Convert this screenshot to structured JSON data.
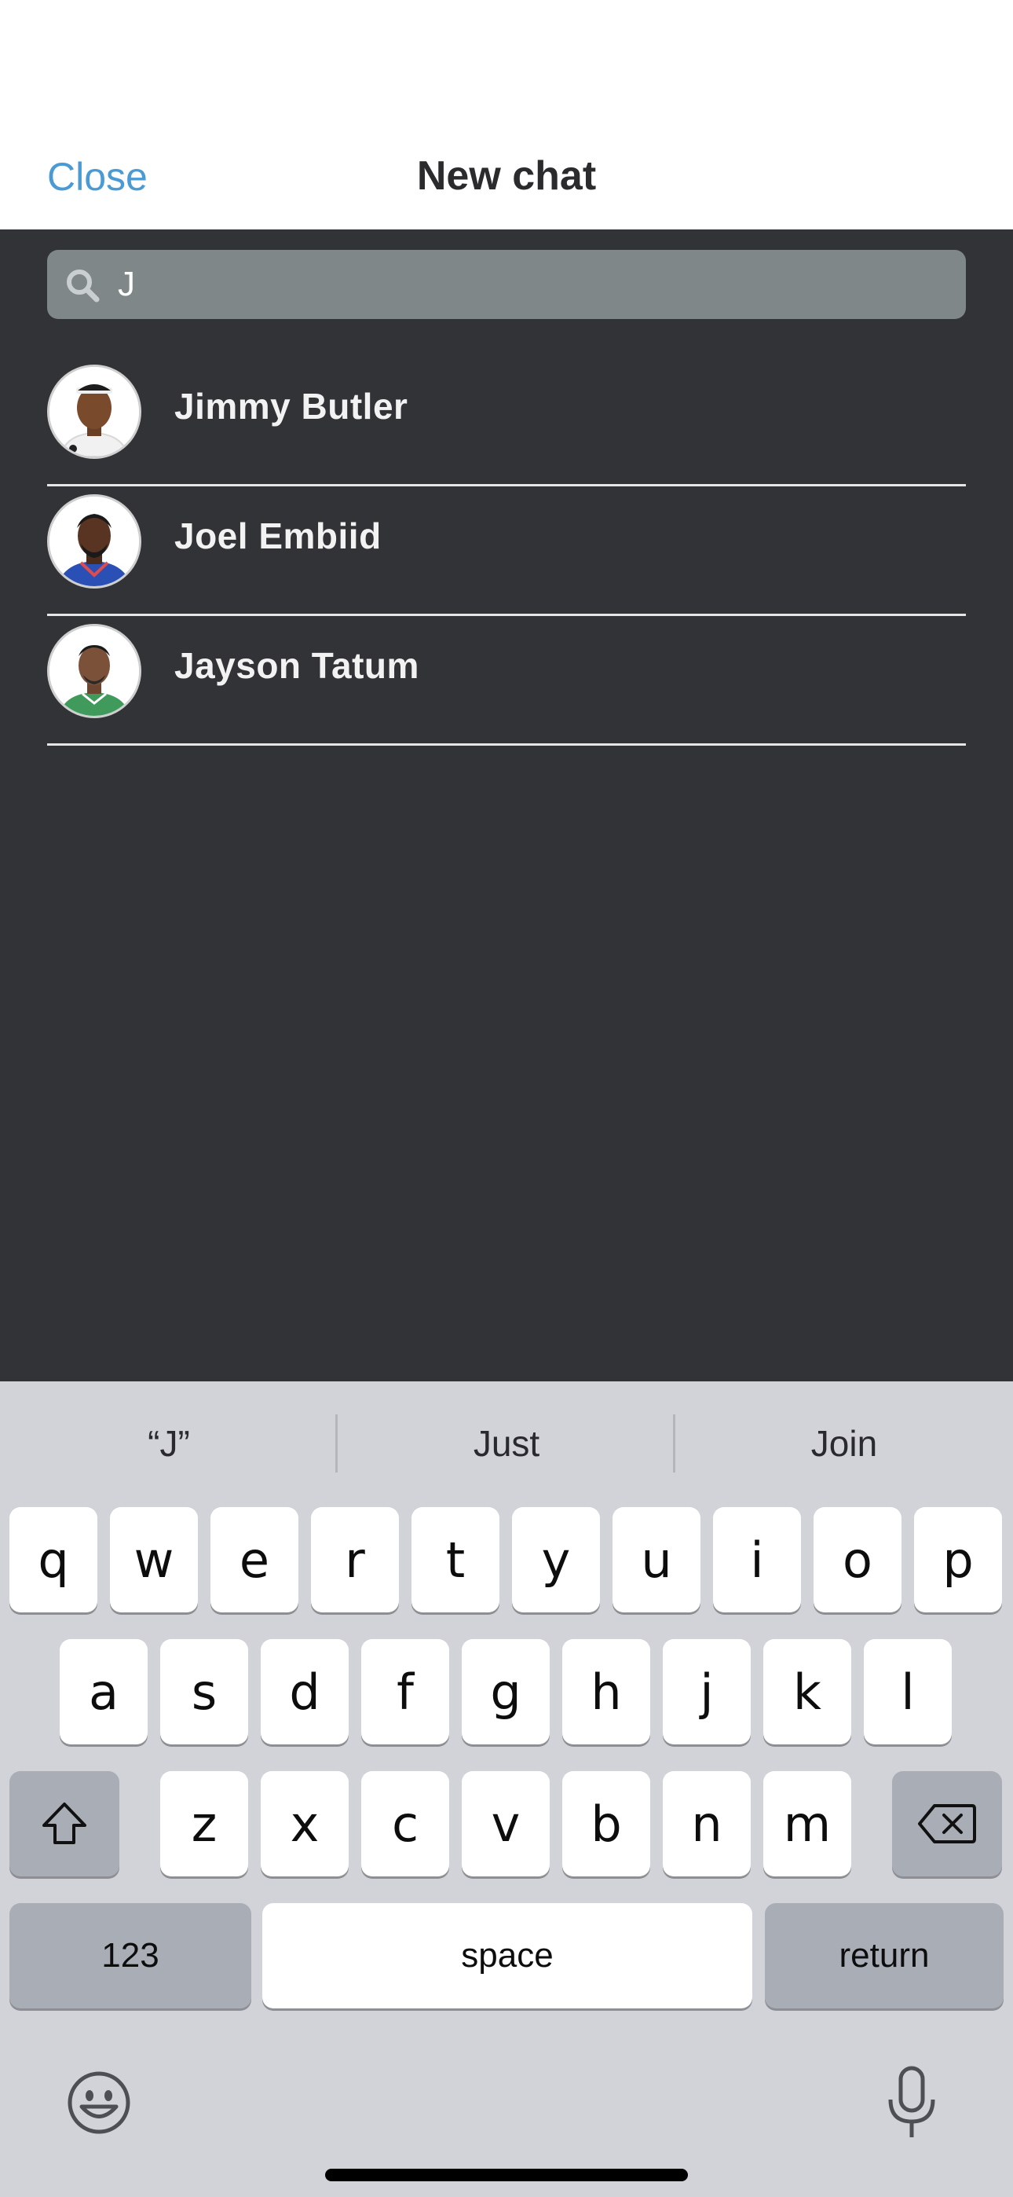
{
  "header": {
    "close_label": "Close",
    "title": "New chat"
  },
  "search": {
    "value": "J",
    "icon": "search-icon"
  },
  "contacts": [
    {
      "name": "Jimmy Butler",
      "jersey_color": "#ffffff"
    },
    {
      "name": "Joel Embiid",
      "jersey_color": "#2a4fb5"
    },
    {
      "name": "Jayson Tatum",
      "jersey_color": "#3f9a5c"
    }
  ],
  "keyboard": {
    "suggestions": [
      "“J”",
      "Just",
      "Join"
    ],
    "row1": [
      "q",
      "w",
      "e",
      "r",
      "t",
      "y",
      "u",
      "i",
      "o",
      "p"
    ],
    "row2": [
      "a",
      "s",
      "d",
      "f",
      "g",
      "h",
      "j",
      "k",
      "l"
    ],
    "row3": [
      "z",
      "x",
      "c",
      "v",
      "b",
      "n",
      "m"
    ],
    "numbers_label": "123",
    "space_label": "space",
    "return_label": "return",
    "shift_icon": "shift-icon",
    "backspace_icon": "backspace-icon",
    "emoji_icon": "emoji-icon",
    "mic_icon": "microphone-icon"
  },
  "colors": {
    "accent": "#4a9ad4",
    "main_bg": "#323336",
    "search_bg": "#7f8788",
    "keyboard_bg": "#d1d3d9"
  }
}
